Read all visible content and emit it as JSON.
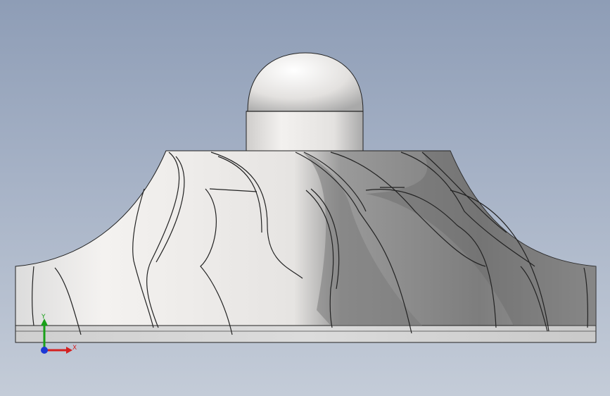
{
  "viewport": {
    "model_name": "impeller",
    "background_top": "#8e9db6",
    "background_bottom": "#c4ccd8"
  },
  "triad": {
    "x_label": "X",
    "y_label": "Y",
    "x_color": "#d42020",
    "y_color": "#19a019",
    "z_color": "#1c38d6"
  }
}
